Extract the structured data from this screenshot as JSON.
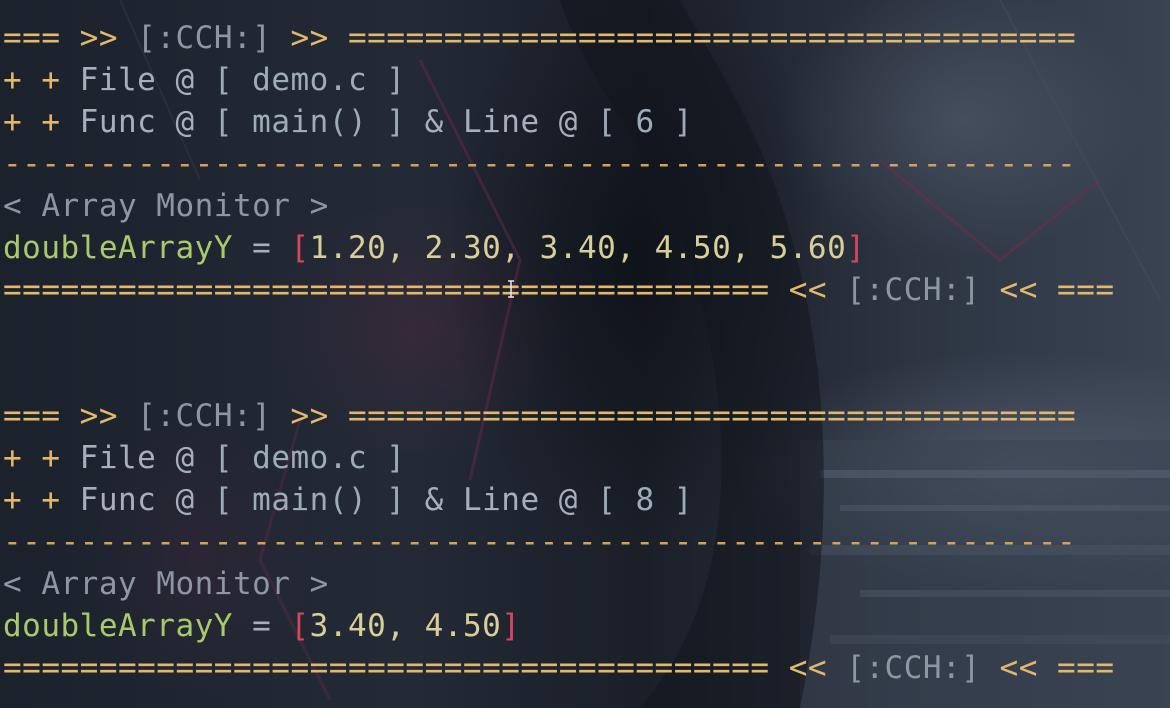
{
  "blocks": [
    {
      "header": {
        "left_rule": "===",
        "arrow_open": ">>",
        "tag": "[:CCH:]",
        "arrow_close": ">>",
        "rule": "======================================"
      },
      "file_line": {
        "prefix": "+ +",
        "label": "File @",
        "value": "[ demo.c ]"
      },
      "func_line": {
        "prefix": "+ +",
        "func_label": "Func @",
        "func_value": "[ main() ]",
        "amp": "&",
        "line_label": "Line @",
        "line_value": "[ 6 ]"
      },
      "divider": "--------------------------------------------------------",
      "monitor_title": "< Array Monitor >",
      "array": {
        "name": "doubleArrayY",
        "op": "=",
        "open": "[",
        "values": "1.20, 2.30, 3.40, 4.50, 5.60",
        "close": "]"
      },
      "footer": {
        "rule": "========================================",
        "arrow_open": "<<",
        "tag": "[:CCH:]",
        "arrow_close": "<<",
        "right_rule": "==="
      }
    },
    {
      "header": {
        "left_rule": "===",
        "arrow_open": ">>",
        "tag": "[:CCH:]",
        "arrow_close": ">>",
        "rule": "======================================"
      },
      "file_line": {
        "prefix": "+ +",
        "label": "File @",
        "value": "[ demo.c ]"
      },
      "func_line": {
        "prefix": "+ +",
        "func_label": "Func @",
        "func_value": "[ main() ]",
        "amp": "&",
        "line_label": "Line @",
        "line_value": "[ 8 ]"
      },
      "divider": "--------------------------------------------------------",
      "monitor_title": "< Array Monitor >",
      "array": {
        "name": "doubleArrayY",
        "op": "=",
        "open": "[",
        "values": "3.40, 4.50",
        "close": "]"
      },
      "footer": {
        "rule": "========================================",
        "arrow_open": "<<",
        "tag": "[:CCH:]",
        "arrow_close": "<<",
        "right_rule": "==="
      }
    }
  ],
  "cursor_icon": "i-beam-cursor-icon",
  "colors": {
    "rule": "#e3b86b",
    "tag": "#8d96a2",
    "variable": "#a9c96d",
    "bracket": "#d8455d",
    "number": "#d7ce98"
  }
}
